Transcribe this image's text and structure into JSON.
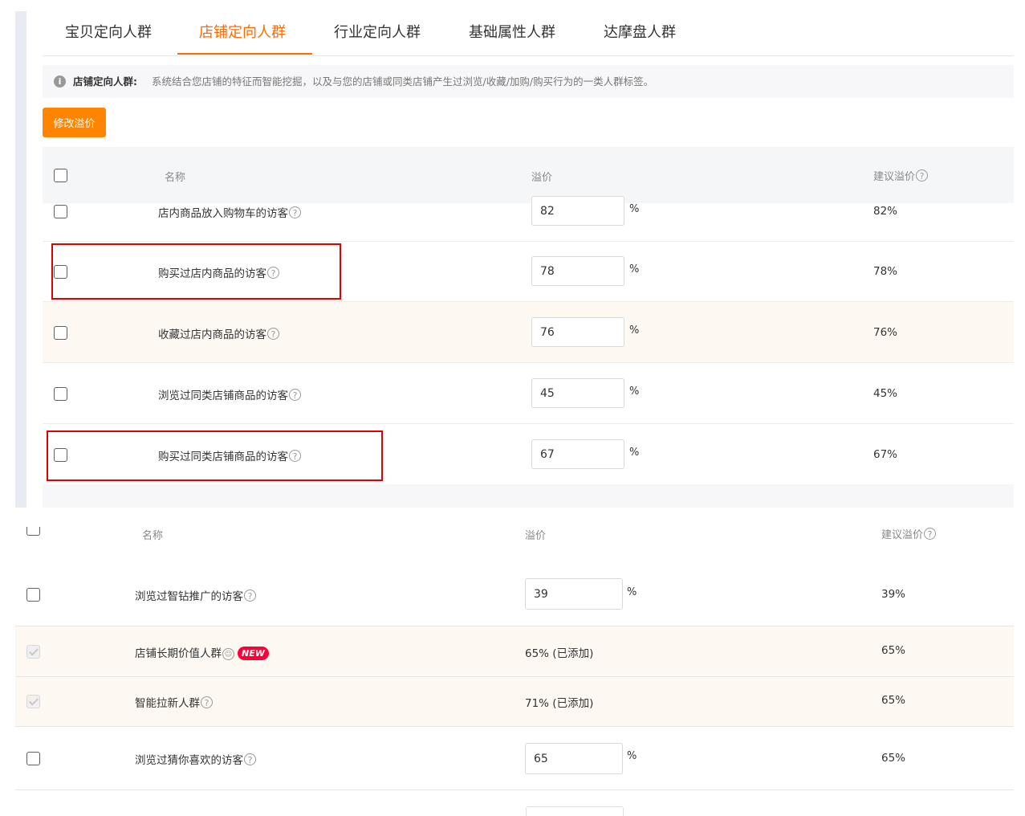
{
  "tabs": [
    {
      "label": "宝贝定向人群",
      "active": false
    },
    {
      "label": "店铺定向人群",
      "active": true
    },
    {
      "label": "行业定向人群",
      "active": false
    },
    {
      "label": "基础属性人群",
      "active": false
    },
    {
      "label": "达摩盘人群",
      "active": false
    }
  ],
  "info": {
    "icon": "info-icon",
    "title": "店铺定向人群:",
    "text": "系统结合您店铺的特征而智能挖掘，以及与您的店铺或同类店铺产生过浏览/收藏/加购/购买行为的一类人群标签。"
  },
  "edit_button": "修改溢价",
  "table_top": {
    "headers": {
      "name": "名称",
      "premium": "溢价",
      "suggested": "建议溢价"
    },
    "rows": [
      {
        "name": "店内商品放入购物车的访客",
        "value": "82",
        "unit": "%",
        "suggested": "82%",
        "highlighted": false
      },
      {
        "name": "购买过店内商品的访客",
        "value": "78",
        "unit": "%",
        "suggested": "78%",
        "highlighted": false
      },
      {
        "name": "收藏过店内商品的访客",
        "value": "76",
        "unit": "%",
        "suggested": "76%",
        "highlighted": true
      },
      {
        "name": "浏览过同类店铺商品的访客",
        "value": "45",
        "unit": "%",
        "suggested": "45%",
        "highlighted": false
      },
      {
        "name": "购买过同类店铺商品的访客",
        "value": "67",
        "unit": "%",
        "suggested": "67%",
        "highlighted": false
      }
    ]
  },
  "table_bottom": {
    "headers": {
      "name": "名称",
      "premium": "溢价",
      "suggested": "建议溢价"
    },
    "rows": [
      {
        "name": "浏览过智钻推广的访客",
        "value": "39",
        "unit": "%",
        "suggested": "39%",
        "added": false
      },
      {
        "name": "店铺长期价值人群",
        "badge": "NEW",
        "status": "65% (已添加)",
        "suggested": "65%",
        "added": true
      },
      {
        "name": "智能拉新人群",
        "status": "71% (已添加)",
        "suggested": "65%",
        "added": true
      },
      {
        "name": "浏览过猜你喜欢的访客",
        "value": "65",
        "unit": "%",
        "suggested": "65%",
        "added": false
      }
    ]
  },
  "colors": {
    "accent": "#ff6a00",
    "button": "#ff8400",
    "highlight_box": "#e00000",
    "badge": "#ff0036"
  }
}
